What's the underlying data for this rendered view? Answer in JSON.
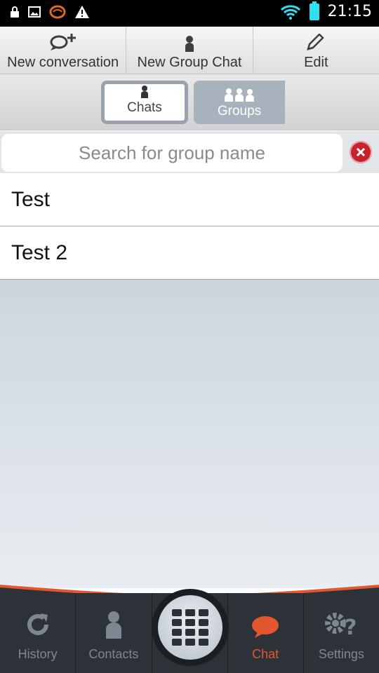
{
  "status": {
    "time": "21:15"
  },
  "actions": [
    {
      "label": "New conversation",
      "icon": "new-conversation-icon"
    },
    {
      "label": "New Group Chat",
      "icon": "person-icon"
    },
    {
      "label": "Edit",
      "icon": "pencil-icon"
    }
  ],
  "tabs": {
    "chats": "Chats",
    "groups": "Groups",
    "selected": "Groups"
  },
  "search": {
    "placeholder": "Search for group name",
    "value": ""
  },
  "groups": [
    "Test",
    "Test 2"
  ],
  "nav": {
    "history": "History",
    "contacts": "Contacts",
    "chat": "Chat",
    "settings": "Settings",
    "active": "Chat"
  },
  "colors": {
    "accent": "#e4572e",
    "clear_button": "#c6232b",
    "nav_bg": "#2d3238"
  }
}
